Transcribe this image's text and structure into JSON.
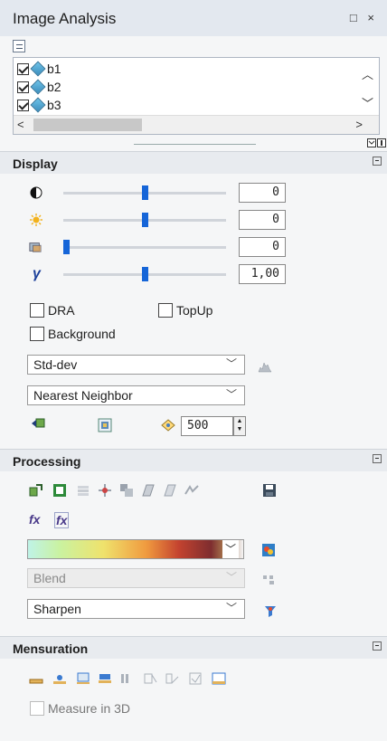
{
  "window": {
    "title": "Image Analysis",
    "restore_icon": "□",
    "close_icon": "×"
  },
  "layers": {
    "items": [
      {
        "label": "b1",
        "checked": true
      },
      {
        "label": "b2",
        "checked": true
      },
      {
        "label": "b3",
        "checked": true
      }
    ],
    "scroll_left": "<",
    "scroll_right": ">",
    "scroll_up": "^",
    "scroll_down": "v"
  },
  "display": {
    "header": "Display",
    "contrast": {
      "value": "0",
      "level": 0.5
    },
    "brightness": {
      "value": "0",
      "level": 0.5
    },
    "transparency": {
      "value": "0",
      "level": 0.0
    },
    "gamma": {
      "symbol": "γ",
      "value": "1,00",
      "level": 0.5
    },
    "dra_label": "DRA",
    "topup_label": "TopUp",
    "background_label": "Background",
    "stretch_type": "Std-dev",
    "resampling": "Nearest Neighbor",
    "scale_value": "500"
  },
  "processing": {
    "header": "Processing",
    "blend": "Blend",
    "sharpen": "Sharpen"
  },
  "mensuration": {
    "header": "Mensuration",
    "measure_3d_label": "Measure in 3D"
  },
  "colors": {
    "accent": "#1565d8",
    "header_bg": "#e8ebef",
    "title_bg": "#e3e8ef"
  }
}
